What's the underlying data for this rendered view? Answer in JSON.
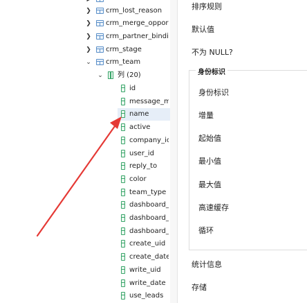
{
  "tree": {
    "tables_top": [
      {
        "label": "crm_lost_reason"
      },
      {
        "label": "crm_merge_oppor"
      },
      {
        "label": "crm_partner_bindi"
      },
      {
        "label": "crm_stage"
      }
    ],
    "crm_team": {
      "label": "crm_team"
    },
    "columns_folder": {
      "label": "列 (20)"
    },
    "columns": [
      {
        "label": "id"
      },
      {
        "label": "message_m"
      },
      {
        "label": "name"
      },
      {
        "label": "active"
      },
      {
        "label": "company_ic"
      },
      {
        "label": "user_id"
      },
      {
        "label": "reply_to"
      },
      {
        "label": "color"
      },
      {
        "label": "team_type"
      },
      {
        "label": "dashboard_"
      },
      {
        "label": "dashboard_"
      },
      {
        "label": "dashboard_"
      },
      {
        "label": "create_uid"
      },
      {
        "label": "create_date"
      },
      {
        "label": "write_uid"
      },
      {
        "label": "write_date"
      },
      {
        "label": "use_leads"
      }
    ],
    "selected_column": "name"
  },
  "props": {
    "sort_rule": "排序规则",
    "default_value": "默认值",
    "not_null": "不为 NULL?",
    "identity_group_title": "身份标识",
    "identity_items": [
      {
        "label": "身份标识"
      },
      {
        "label": "增量"
      },
      {
        "label": "起始值"
      },
      {
        "label": "最小值"
      },
      {
        "label": "最大值"
      },
      {
        "label": "高速缓存"
      },
      {
        "label": "循环"
      }
    ],
    "statistics": "统计信息",
    "storage": "存储"
  },
  "colors": {
    "selection": "#e6eef8",
    "column_icon": "#3aa56a",
    "table_icon": "#5a8fc8",
    "annotation_arrow": "#e53935"
  },
  "icons": {
    "table": "table-icon",
    "columns_folder": "columns-folder-icon",
    "column": "column-icon",
    "chevron_right": "chevron-right-icon",
    "chevron_down": "chevron-down-icon"
  }
}
